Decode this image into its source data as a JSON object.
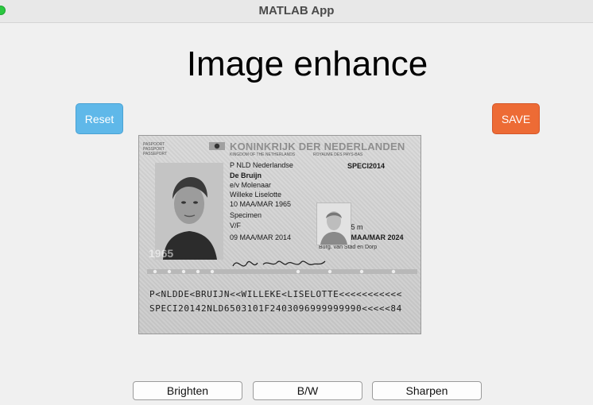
{
  "window": {
    "title": "MATLAB App"
  },
  "app": {
    "title": "Image enhance"
  },
  "buttons": {
    "reset": "Reset",
    "save": "SAVE",
    "brighten": "Brighten",
    "bw": "B/W",
    "sharpen": "Sharpen"
  },
  "colors": {
    "reset_button": "#5fb8e9",
    "save_button": "#ed6b35",
    "window_control": "#2bc840"
  },
  "passport_image": {
    "header": "KONINKRIJK DER NEDERLANDEN",
    "kingdom": "KINGDOM OF THE NETHERLANDS",
    "royaume": "ROYAUME DES PAYS-BAS",
    "pass_type": "PASPOORT\nPASSPORT\nPASSEPORT",
    "nationality_line": "P   NLD Nederlandse",
    "document_no": "SPECI2014",
    "surname": "De Bruijn",
    "spouse": "e/v Molenaar",
    "given_names": "Willeke Liselotte",
    "birth_date": "10 MAA/MAR 1965",
    "place": "Specimen",
    "sex": "V/F",
    "issue_date": "09 MAA/MAR 2014",
    "height": "1,75 m",
    "expiry_date": "09 MAA/MAR 2024",
    "authority": "Burg. van Stad en Dorp",
    "photo_year": "1965",
    "mrz_line_1": "P<NLDDE<BRUIJN<<WILLEKE<LISELOTTE<<<<<<<<<<<",
    "mrz_line_2": "SPECI20142NLD6503101F2403096999999990<<<<<84"
  }
}
